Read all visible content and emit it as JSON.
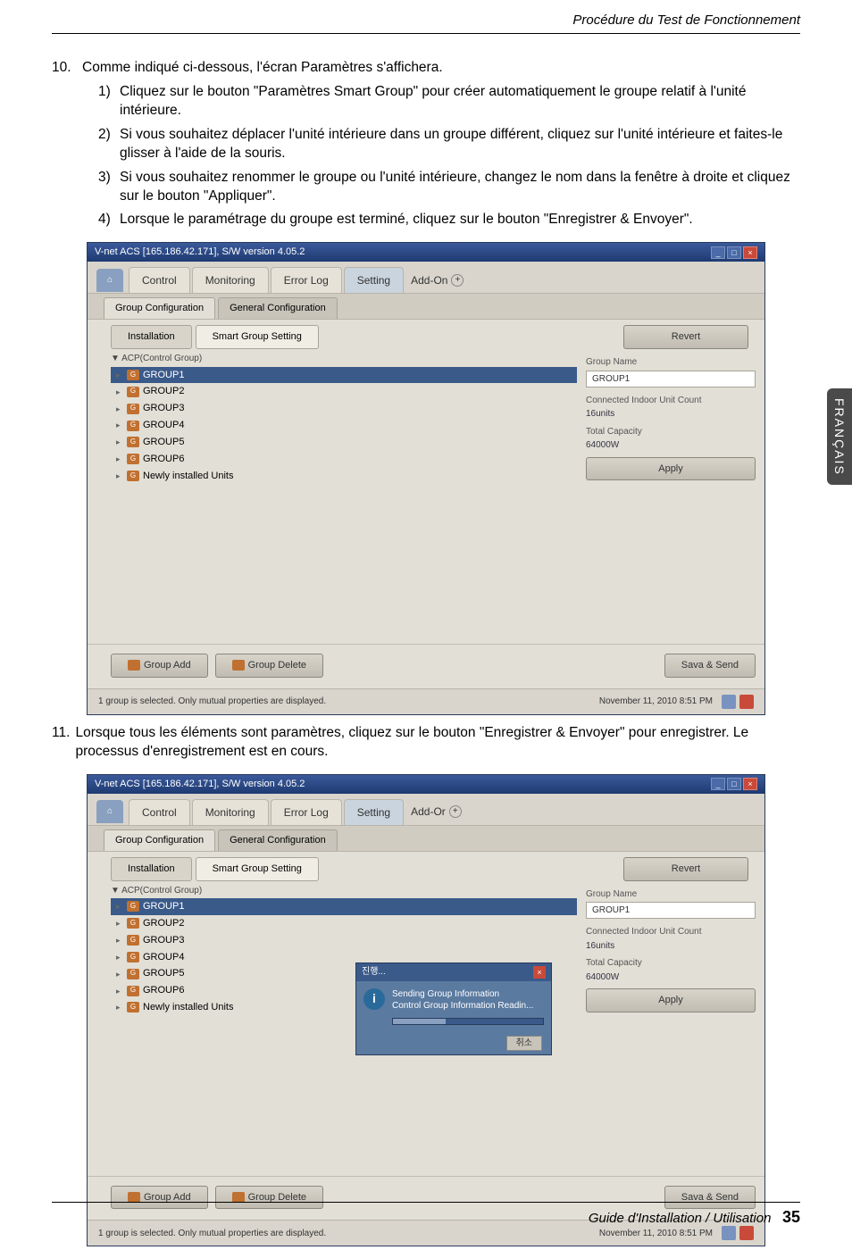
{
  "header": {
    "title": "Procédure du Test de Fonctionnement"
  },
  "side_tab": "FRANÇAIS",
  "step10": {
    "num": "10.",
    "text": "Comme indiqué ci-dessous, l'écran Paramètres s'affichera.",
    "items": [
      {
        "n": "1)",
        "t": "Cliquez sur le bouton \"Paramètres Smart Group\" pour créer automatiquement le groupe relatif à l'unité intérieure."
      },
      {
        "n": "2)",
        "t": "Si vous souhaitez déplacer l'unité intérieure dans un groupe différent, cliquez sur l'unité intérieure et faites-le glisser à l'aide de la souris."
      },
      {
        "n": "3)",
        "t": "Si vous souhaitez renommer le groupe ou l'unité intérieure, changez le nom dans la fenêtre à droite et cliquez sur le bouton \"Appliquer\"."
      },
      {
        "n": "4)",
        "t": "Lorsque le paramétrage du groupe est terminé, cliquez sur le bouton \"Enregistrer & Envoyer\"."
      }
    ]
  },
  "app1": {
    "title": "V-net ACS [165.186.42.171],   S/W version 4.05.2",
    "tabs": {
      "home": "Home",
      "control": "Control",
      "monitoring": "Monitoring",
      "errorlog": "Error Log",
      "setting": "Setting",
      "addon": "Add-On"
    },
    "subtabs": {
      "group": "Group Configuration",
      "general": "General Configuration"
    },
    "subtabs2": {
      "installation": "Installation",
      "smartgroup": "Smart Group Setting"
    },
    "buttons": {
      "revert": "Revert",
      "apply": "Apply",
      "groupadd": "Group Add",
      "groupdelete": "Group Delete",
      "savesend": "Sava & Send"
    },
    "tree_header": "▼ ACP(Control Group)",
    "tree": [
      {
        "label": "GROUP1",
        "selected": true
      },
      {
        "label": "GROUP2",
        "selected": false
      },
      {
        "label": "GROUP3",
        "selected": false
      },
      {
        "label": "GROUP4",
        "selected": false
      },
      {
        "label": "GROUP5",
        "selected": false
      },
      {
        "label": "GROUP6",
        "selected": false
      },
      {
        "label": "Newly installed Units",
        "selected": false
      }
    ],
    "right": {
      "groupname_label": "Group Name",
      "groupname_value": "GROUP1",
      "connected_label": "Connected Indoor Unit Count",
      "connected_value": "16units",
      "capacity_label": "Total Capacity",
      "capacity_value": "64000W"
    },
    "status": {
      "text": "1 group is selected. Only mutual properties are displayed.",
      "time": "November 11, 2010  8:51 PM"
    }
  },
  "step11": {
    "num": "11.",
    "text": "Lorsque tous les éléments sont paramètres, cliquez sur le bouton \"Enregistrer & Envoyer\" pour enregistrer. Le processus d'enregistrement est en cours."
  },
  "app2": {
    "title": "V-net ACS [165.186.42.171],   S/W version 4.05.2",
    "addon": "Add-Or",
    "dialog": {
      "title": "진행...",
      "line1": "Sending Group Information",
      "line2": "Control Group Information Readin...",
      "btn": "취소"
    }
  },
  "footer": {
    "text": "Guide d'Installation / Utilisation",
    "page": "35"
  }
}
